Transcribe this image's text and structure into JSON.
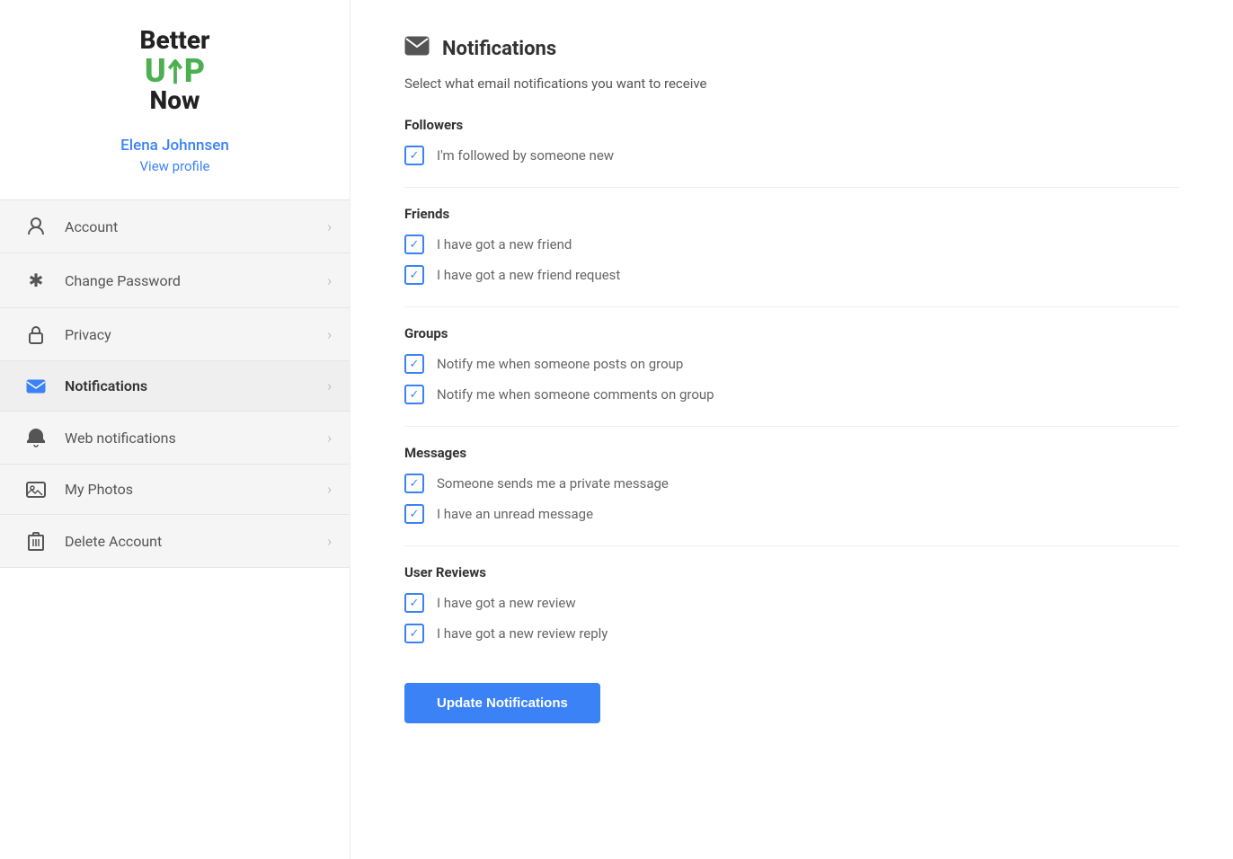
{
  "logo": {
    "better": "Better",
    "up": "UP",
    "now": "Now"
  },
  "user": {
    "name": "Elena Johnnsen",
    "view_profile": "View profile"
  },
  "nav": {
    "items": [
      {
        "id": "account",
        "label": "Account",
        "icon": "person",
        "active": false
      },
      {
        "id": "change-password",
        "label": "Change Password",
        "icon": "asterisk",
        "active": false
      },
      {
        "id": "privacy",
        "label": "Privacy",
        "icon": "lock",
        "active": false
      },
      {
        "id": "notifications",
        "label": "Notifications",
        "icon": "envelope",
        "active": true
      },
      {
        "id": "web-notifications",
        "label": "Web notifications",
        "icon": "bell",
        "active": false
      },
      {
        "id": "my-photos",
        "label": "My Photos",
        "icon": "image",
        "active": false
      },
      {
        "id": "delete-account",
        "label": "Delete Account",
        "icon": "trash",
        "active": false
      }
    ]
  },
  "notifications_page": {
    "title": "Notifications",
    "subtitle": "Select what email notifications you want to receive",
    "groups": [
      {
        "id": "followers",
        "title": "Followers",
        "items": [
          {
            "id": "followed-new",
            "label": "I'm followed by someone new",
            "checked": true
          }
        ]
      },
      {
        "id": "friends",
        "title": "Friends",
        "items": [
          {
            "id": "new-friend",
            "label": "I have got a new friend",
            "checked": true
          },
          {
            "id": "friend-request",
            "label": "I have got a new friend request",
            "checked": true
          }
        ]
      },
      {
        "id": "groups",
        "title": "Groups",
        "items": [
          {
            "id": "group-post",
            "label": "Notify me when someone posts on group",
            "checked": true
          },
          {
            "id": "group-comment",
            "label": "Notify me when someone comments on group",
            "checked": true
          }
        ]
      },
      {
        "id": "messages",
        "title": "Messages",
        "items": [
          {
            "id": "private-message",
            "label": "Someone sends me a private message",
            "checked": true
          },
          {
            "id": "unread-message",
            "label": "I have an unread message",
            "checked": true
          }
        ]
      },
      {
        "id": "user-reviews",
        "title": "User Reviews",
        "items": [
          {
            "id": "new-review",
            "label": "I have got a new review",
            "checked": true
          },
          {
            "id": "review-reply",
            "label": "I have got a new review reply",
            "checked": true
          }
        ]
      }
    ],
    "update_button": "Update Notifications"
  }
}
